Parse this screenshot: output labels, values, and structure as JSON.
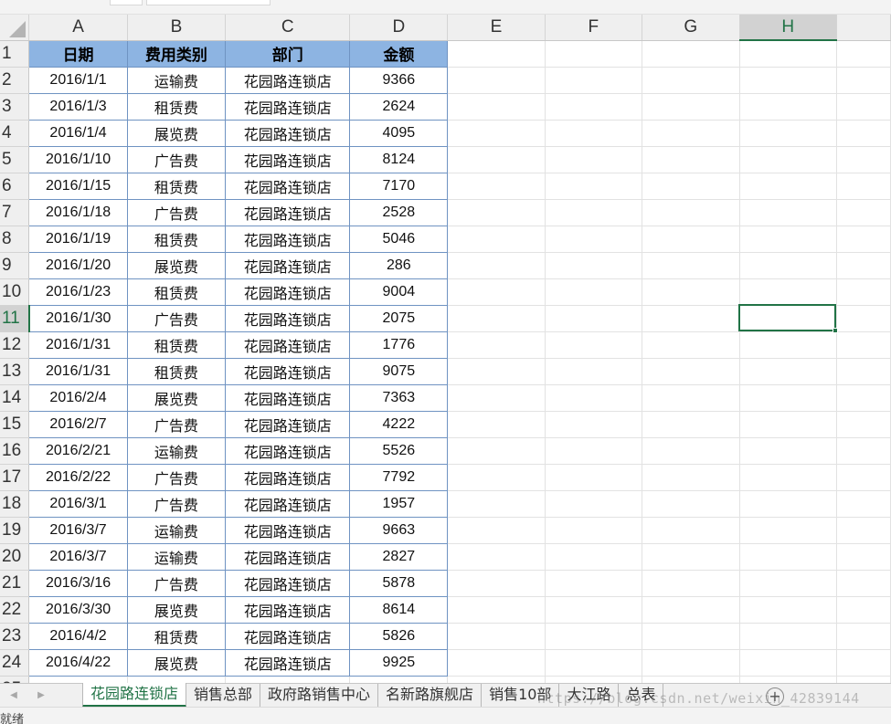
{
  "column_headers": [
    "A",
    "B",
    "C",
    "D",
    "E",
    "F",
    "G",
    "H"
  ],
  "selected_column": "H",
  "selected_row": 11,
  "table": {
    "headers": [
      "日期",
      "费用类别",
      "部门",
      "金额"
    ],
    "rows": [
      [
        "2016/1/1",
        "运输费",
        "花园路连锁店",
        "9366"
      ],
      [
        "2016/1/3",
        "租赁费",
        "花园路连锁店",
        "2624"
      ],
      [
        "2016/1/4",
        "展览费",
        "花园路连锁店",
        "4095"
      ],
      [
        "2016/1/10",
        "广告费",
        "花园路连锁店",
        "8124"
      ],
      [
        "2016/1/15",
        "租赁费",
        "花园路连锁店",
        "7170"
      ],
      [
        "2016/1/18",
        "广告费",
        "花园路连锁店",
        "2528"
      ],
      [
        "2016/1/19",
        "租赁费",
        "花园路连锁店",
        "5046"
      ],
      [
        "2016/1/20",
        "展览费",
        "花园路连锁店",
        "286"
      ],
      [
        "2016/1/23",
        "租赁费",
        "花园路连锁店",
        "9004"
      ],
      [
        "2016/1/30",
        "广告费",
        "花园路连锁店",
        "2075"
      ],
      [
        "2016/1/31",
        "租赁费",
        "花园路连锁店",
        "1776"
      ],
      [
        "2016/1/31",
        "租赁费",
        "花园路连锁店",
        "9075"
      ],
      [
        "2016/2/4",
        "展览费",
        "花园路连锁店",
        "7363"
      ],
      [
        "2016/2/7",
        "广告费",
        "花园路连锁店",
        "4222"
      ],
      [
        "2016/2/21",
        "运输费",
        "花园路连锁店",
        "5526"
      ],
      [
        "2016/2/22",
        "广告费",
        "花园路连锁店",
        "7792"
      ],
      [
        "2016/3/1",
        "广告费",
        "花园路连锁店",
        "1957"
      ],
      [
        "2016/3/7",
        "运输费",
        "花园路连锁店",
        "9663"
      ],
      [
        "2016/3/7",
        "运输费",
        "花园路连锁店",
        "2827"
      ],
      [
        "2016/3/16",
        "广告费",
        "花园路连锁店",
        "5878"
      ],
      [
        "2016/3/30",
        "展览费",
        "花园路连锁店",
        "8614"
      ],
      [
        "2016/4/2",
        "租赁费",
        "花园路连锁店",
        "5826"
      ],
      [
        "2016/4/22",
        "展览费",
        "花园路连锁店",
        "9925"
      ]
    ]
  },
  "sheet_tabs": [
    "花园路连锁店",
    "销售总部",
    "政府路销售中心",
    "名新路旗舰店",
    "销售10部",
    "大江路",
    "总表"
  ],
  "active_sheet": "花园路连锁店",
  "add_sheet_label": "+",
  "nav_left": "◀",
  "nav_right": "▶",
  "watermark": "https://blog.csdn.net/weixin_42839144",
  "status": "就绪",
  "colors": {
    "header_fill": "#8db4e2",
    "accent": "#217346",
    "table_border": "#6f93c2"
  }
}
